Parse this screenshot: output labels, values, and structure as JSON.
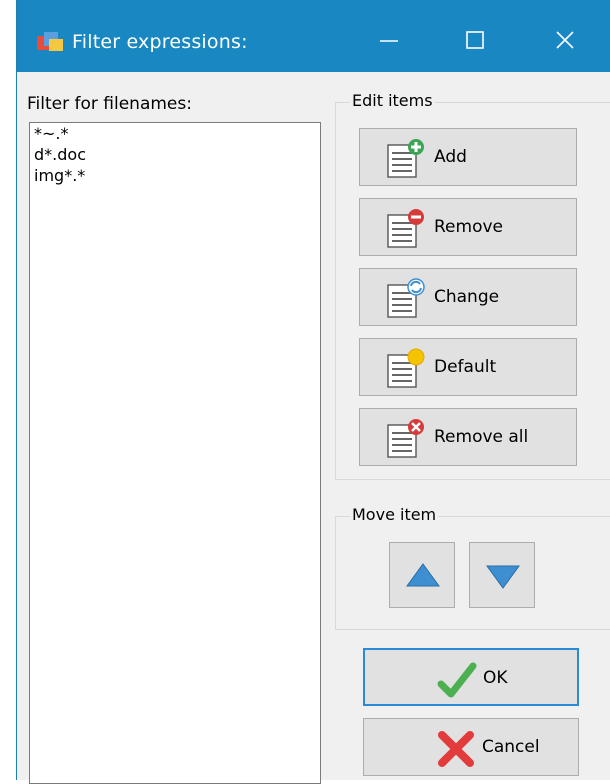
{
  "window": {
    "title": "Filter expressions:",
    "icon": "filter-app-icon",
    "controls": {
      "minimize": "minimize-icon",
      "maximize": "maximize-icon",
      "close": "close-icon"
    }
  },
  "list": {
    "label": "Filter for filenames:",
    "items": [
      "*~.*",
      "d*.doc",
      "img*.*"
    ]
  },
  "edit_group": {
    "title": "Edit items",
    "buttons": [
      {
        "label": "Add",
        "icon": "add-list-icon"
      },
      {
        "label": "Remove",
        "icon": "remove-list-icon"
      },
      {
        "label": "Change",
        "icon": "change-list-icon"
      },
      {
        "label": "Default",
        "icon": "default-list-icon"
      },
      {
        "label": "Remove all",
        "icon": "remove-all-list-icon"
      }
    ]
  },
  "move_group": {
    "title": "Move item",
    "up_icon": "arrow-up-icon",
    "down_icon": "arrow-down-icon"
  },
  "dialog_buttons": {
    "ok": {
      "label": "OK",
      "icon": "checkmark-icon"
    },
    "cancel": {
      "label": "Cancel",
      "icon": "cross-icon"
    }
  },
  "colors": {
    "titlebar": "#1887c2",
    "focus_border": "#2b8ad6",
    "arrow_blue": "#3d8fd1"
  }
}
